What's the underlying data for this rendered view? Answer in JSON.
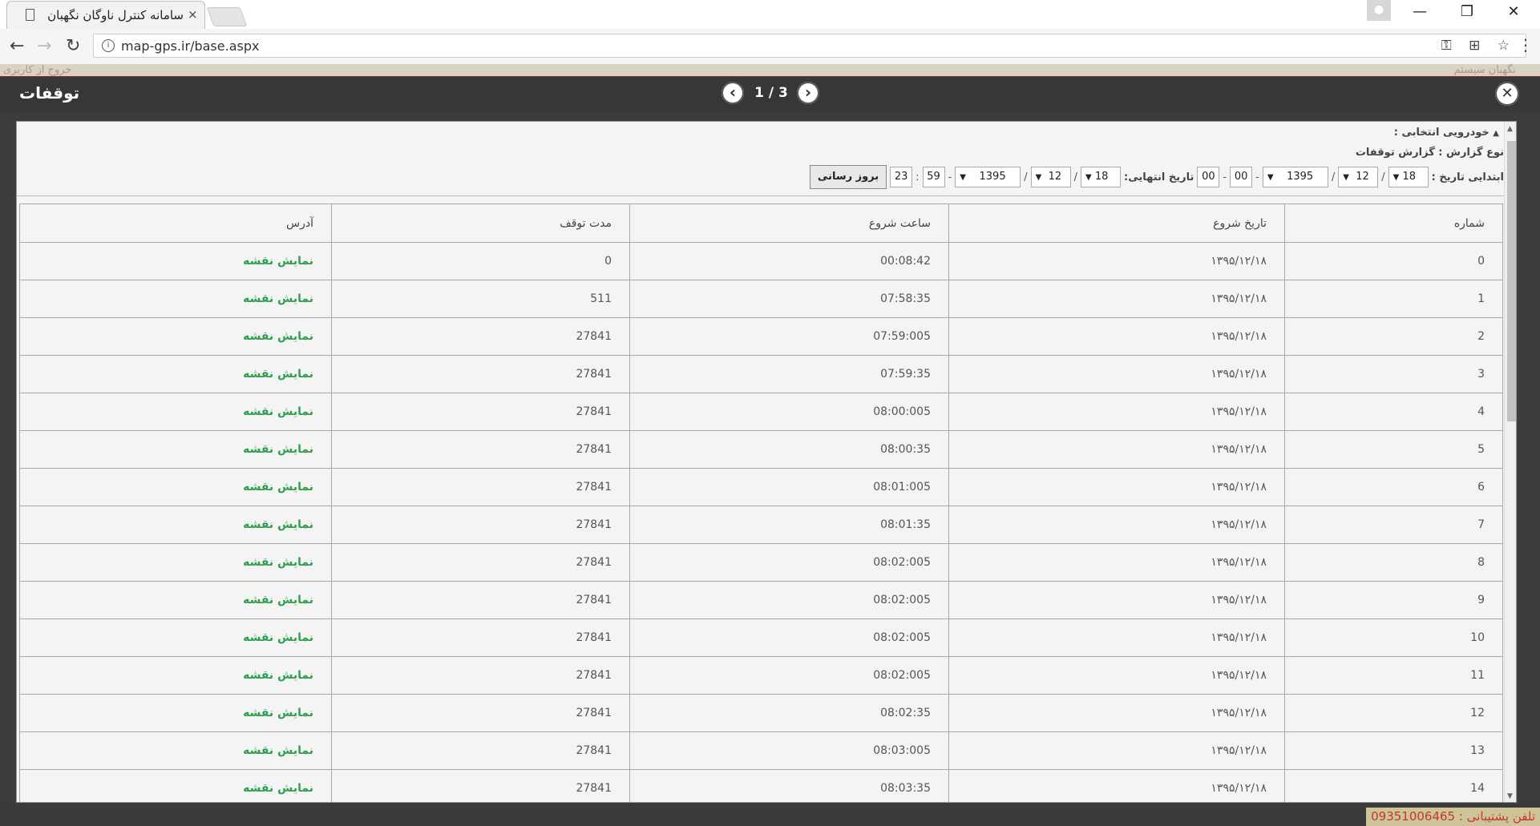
{
  "browser": {
    "tab_title": "سامانه کنترل ناوگان نگهبان",
    "tab_close": "×",
    "url": "map-gps.ir/base.aspx",
    "url_info": "i",
    "url_icons": "⚿ ⊞ ☆",
    "back": "←",
    "forward": "→",
    "reload": "↻",
    "menu": "⋮",
    "profile": "👤",
    "minimize": "—",
    "maximize": "❐",
    "close": "✕"
  },
  "background": {
    "left_text": "خروج از کاربری",
    "right_text": "نگهبان سیستم"
  },
  "modal": {
    "title": "توقفات",
    "pager": {
      "text": "1 / 3",
      "prev": "‹",
      "next": "›"
    },
    "close": "✕"
  },
  "filters": {
    "selected_vehicle_label": "خودرویی انتخابی :",
    "report_type_label": "نوع گزارش :",
    "report_type_value": "گزارش توقفات",
    "start_date_label": "ابتدایی تاریخ :",
    "start_day": "18",
    "start_month": "12",
    "start_year": "1395",
    "start_hour": "00",
    "start_minute": "00",
    "end_date_label": "تاریخ انتهایی:",
    "end_day": "18",
    "end_month": "12",
    "end_year": "1395",
    "end_hour": "59",
    "end_minute": "23",
    "refresh_label": "بروز رسانی",
    "date_sep": "/",
    "time_sep": ":",
    "dash": "-"
  },
  "table": {
    "headers": [
      "شماره",
      "تاریخ شروع",
      "ساعت شروع",
      "مدت توقف",
      "آدرس"
    ],
    "rows": [
      {
        "num": "0",
        "date": "۱۳۹۵/۱۲/۱۸",
        "time": "00:08:42",
        "duration": "0",
        "address": "نمایش نقشه"
      },
      {
        "num": "1",
        "date": "۱۳۹۵/۱۲/۱۸",
        "time": "07:58:35",
        "duration": "511",
        "address": "نمایش نقشه"
      },
      {
        "num": "2",
        "date": "۱۳۹۵/۱۲/۱۸",
        "time": "07:59:005",
        "duration": "27841",
        "address": "نمایش نقشه"
      },
      {
        "num": "3",
        "date": "۱۳۹۵/۱۲/۱۸",
        "time": "07:59:35",
        "duration": "27841",
        "address": "نمایش نقشه"
      },
      {
        "num": "4",
        "date": "۱۳۹۵/۱۲/۱۸",
        "time": "08:00:005",
        "duration": "27841",
        "address": "نمایش نقشه"
      },
      {
        "num": "5",
        "date": "۱۳۹۵/۱۲/۱۸",
        "time": "08:00:35",
        "duration": "27841",
        "address": "نمایش نقشه"
      },
      {
        "num": "6",
        "date": "۱۳۹۵/۱۲/۱۸",
        "time": "08:01:005",
        "duration": "27841",
        "address": "نمایش نقشه"
      },
      {
        "num": "7",
        "date": "۱۳۹۵/۱۲/۱۸",
        "time": "08:01:35",
        "duration": "27841",
        "address": "نمایش نقشه"
      },
      {
        "num": "8",
        "date": "۱۳۹۵/۱۲/۱۸",
        "time": "08:02:005",
        "duration": "27841",
        "address": "نمایش نقشه"
      },
      {
        "num": "9",
        "date": "۱۳۹۵/۱۲/۱۸",
        "time": "08:02:005",
        "duration": "27841",
        "address": "نمایش نقشه"
      },
      {
        "num": "10",
        "date": "۱۳۹۵/۱۲/۱۸",
        "time": "08:02:005",
        "duration": "27841",
        "address": "نمایش نقشه"
      },
      {
        "num": "11",
        "date": "۱۳۹۵/۱۲/۱۸",
        "time": "08:02:005",
        "duration": "27841",
        "address": "نمایش نقشه"
      },
      {
        "num": "12",
        "date": "۱۳۹۵/۱۲/۱۸",
        "time": "08:02:35",
        "duration": "27841",
        "address": "نمایش نقشه"
      },
      {
        "num": "13",
        "date": "۱۳۹۵/۱۲/۱۸",
        "time": "08:03:005",
        "duration": "27841",
        "address": "نمایش نقشه"
      },
      {
        "num": "14",
        "date": "۱۳۹۵/۱۲/۱۸",
        "time": "08:03:35",
        "duration": "27841",
        "address": "نمایش نقشه"
      }
    ]
  },
  "footer": {
    "support_label": "تلفن پشتیبانی :",
    "support_phone": "09351006465"
  },
  "colors": {
    "link_green": "#2f9f4f",
    "modal_header": "#373737",
    "support_text": "#c0392b"
  }
}
